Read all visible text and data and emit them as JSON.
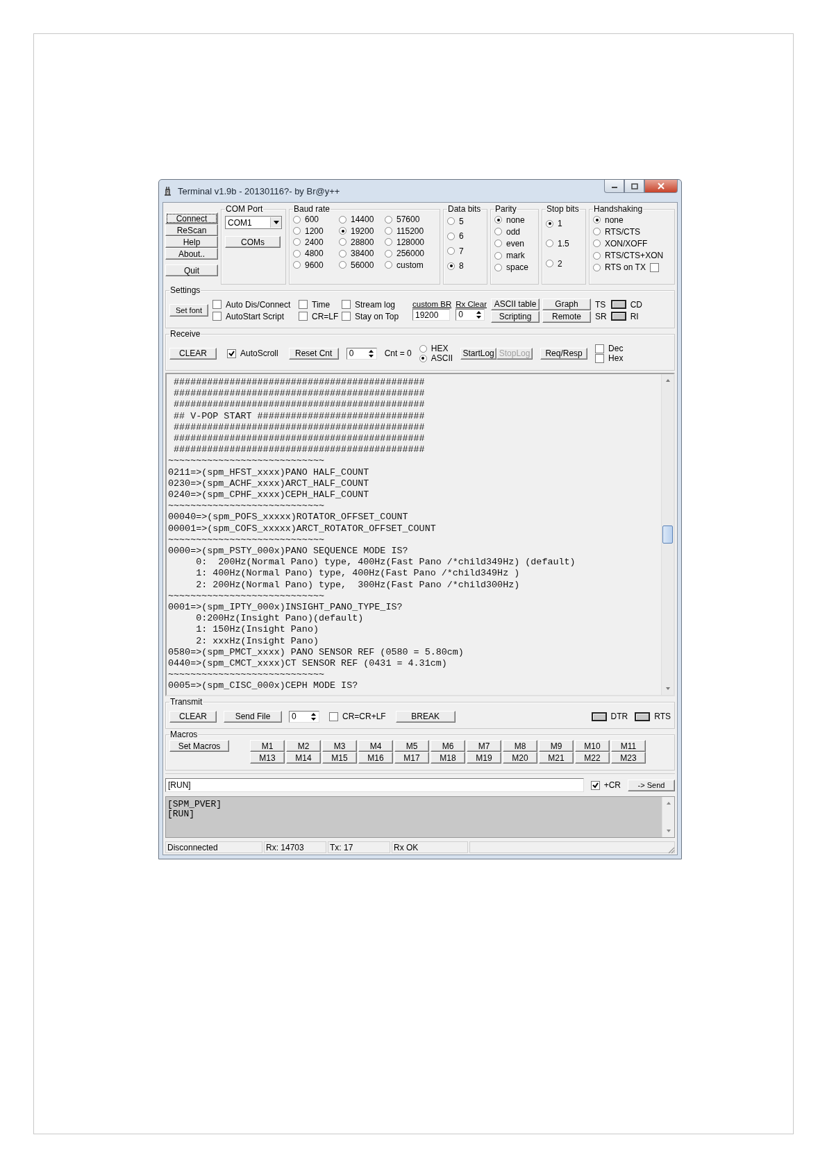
{
  "window": {
    "title": "Terminal v1.9b - 20130116?- by Br@y++"
  },
  "connection_buttons": [
    "Connect",
    "ReScan",
    "Help",
    "About..",
    "Quit"
  ],
  "com_port": {
    "title": "COM Port",
    "value": "COM1",
    "button": "COMs"
  },
  "baud_rate": {
    "title": "Baud rate",
    "options": [
      {
        "label": "600",
        "selected": false
      },
      {
        "label": "1200",
        "selected": false
      },
      {
        "label": "2400",
        "selected": false
      },
      {
        "label": "4800",
        "selected": false
      },
      {
        "label": "9600",
        "selected": false
      },
      {
        "label": "14400",
        "selected": false
      },
      {
        "label": "19200",
        "selected": true
      },
      {
        "label": "28800",
        "selected": false
      },
      {
        "label": "38400",
        "selected": false
      },
      {
        "label": "56000",
        "selected": false
      },
      {
        "label": "57600",
        "selected": false
      },
      {
        "label": "115200",
        "selected": false
      },
      {
        "label": "128000",
        "selected": false
      },
      {
        "label": "256000",
        "selected": false
      },
      {
        "label": "custom",
        "selected": false
      }
    ]
  },
  "data_bits": {
    "title": "Data bits",
    "options": [
      {
        "label": "5",
        "selected": false
      },
      {
        "label": "6",
        "selected": false
      },
      {
        "label": "7",
        "selected": false
      },
      {
        "label": "8",
        "selected": true
      }
    ]
  },
  "parity": {
    "title": "Parity",
    "options": [
      {
        "label": "none",
        "selected": true
      },
      {
        "label": "odd",
        "selected": false
      },
      {
        "label": "even",
        "selected": false
      },
      {
        "label": "mark",
        "selected": false
      },
      {
        "label": "space",
        "selected": false
      }
    ]
  },
  "stop_bits": {
    "title": "Stop bits",
    "options": [
      {
        "label": "1",
        "selected": true
      },
      {
        "label": "1.5",
        "selected": false
      },
      {
        "label": "2",
        "selected": false
      }
    ]
  },
  "handshaking": {
    "title": "Handshaking",
    "options": [
      {
        "label": "none",
        "selected": true
      },
      {
        "label": "RTS/CTS",
        "selected": false
      },
      {
        "label": "XON/XOFF",
        "selected": false
      },
      {
        "label": "RTS/CTS+XON",
        "selected": false
      },
      {
        "label": "RTS on TX",
        "selected": false
      }
    ],
    "rts_on_tx_checked": false
  },
  "settings": {
    "title": "Settings",
    "set_font": "Set font",
    "checkboxes": [
      {
        "label": "Auto Dis/Connect",
        "checked": false
      },
      {
        "label": "AutoStart Script",
        "checked": false
      },
      {
        "label": "Time",
        "checked": false
      },
      {
        "label": "CR=LF",
        "checked": false
      },
      {
        "label": "Stream log",
        "checked": false
      },
      {
        "label": "Stay on Top",
        "checked": false
      }
    ],
    "custom_br": {
      "label": "custom BR",
      "value": "19200"
    },
    "rx_clear": {
      "label": "Rx Clear",
      "value": "0"
    },
    "buttons": [
      "ASCII table",
      "Graph",
      "Scripting",
      "Remote"
    ],
    "line_labels": [
      "TS",
      "SR"
    ],
    "leds": [
      {
        "label": "CD"
      },
      {
        "label": "RI"
      }
    ]
  },
  "receive": {
    "title": "Receive",
    "clear": "CLEAR",
    "autoscroll": {
      "label": "AutoScroll",
      "checked": true
    },
    "reset_cnt": "Reset Cnt",
    "counter": "0",
    "cnt": "Cnt = 0",
    "modes": [
      {
        "label": "HEX",
        "selected": false
      },
      {
        "label": "ASCII",
        "selected": true
      }
    ],
    "log_buttons": [
      {
        "label": "StartLog",
        "disabled": false
      },
      {
        "label": "StopLog",
        "disabled": true
      }
    ],
    "req_resp": "Req/Resp",
    "formats": [
      {
        "label": "Dec",
        "checked": false
      },
      {
        "label": "Hex",
        "checked": false
      }
    ]
  },
  "terminal": {
    "lines": [
      " #############################################",
      " #############################################",
      " #############################################",
      " ## V-POP START ##############################",
      " #############################################",
      " #############################################",
      " #############################################",
      "~~~~~~~~~~~~~~~~~~~~~~~~~~~~",
      "0211=>(spm_HFST_xxxx)PANO HALF_COUNT",
      "0230=>(spm_ACHF_xxxx)ARCT_HALF_COUNT",
      "0240=>(spm_CPHF_xxxx)CEPH_HALF_COUNT",
      "~~~~~~~~~~~~~~~~~~~~~~~~~~~~",
      "00040=>(spm_POFS_xxxxx)ROTATOR_OFFSET_COUNT",
      "00001=>(spm_COFS_xxxxx)ARCT_ROTATOR_OFFSET_COUNT",
      "~~~~~~~~~~~~~~~~~~~~~~~~~~~~",
      "0000=>(spm_PSTY_000x)PANO SEQUENCE MODE IS?",
      "     0:  200Hz(Normal Pano) type, 400Hz(Fast Pano /*child349Hz) (default)",
      "     1: 400Hz(Normal Pano) type, 400Hz(Fast Pano /*child349Hz )",
      "     2: 200Hz(Normal Pano) type,  300Hz(Fast Pano /*child300Hz)",
      "~~~~~~~~~~~~~~~~~~~~~~~~~~~~",
      "0001=>(spm_IPTY_000x)INSIGHT_PANO_TYPE_IS?",
      "     0:200Hz(Insight Pano)(default)",
      "     1: 150Hz(Insight Pano)",
      "     2: xxxHz(Insight Pano)",
      "0580=>(spm_PMCT_xxxx) PANO SENSOR REF (0580 = 5.80cm)",
      "0440=>(spm_CMCT_xxxx)CT SENSOR REF (0431 = 4.31cm)",
      "~~~~~~~~~~~~~~~~~~~~~~~~~~~~",
      "0005=>(spm_CISC_000x)CEPH MODE IS?"
    ]
  },
  "transmit": {
    "title": "Transmit",
    "clear": "CLEAR",
    "send_file": "Send File",
    "counter": "0",
    "cr_lf": {
      "label": "CR=CR+LF",
      "checked": false
    },
    "break": "BREAK",
    "leds": [
      {
        "label": "DTR"
      },
      {
        "label": "RTS"
      }
    ]
  },
  "macros": {
    "title": "Macros",
    "set_macros": "Set Macros",
    "rows": [
      [
        "M1",
        "M2",
        "M3",
        "M4",
        "M5",
        "M6",
        "M7",
        "M8",
        "M9",
        "M10",
        "M11"
      ],
      [
        "M13",
        "M14",
        "M15",
        "M16",
        "M17",
        "M18",
        "M19",
        "M20",
        "M21",
        "M22",
        "M23"
      ]
    ]
  },
  "send_bar": {
    "value": "[RUN]",
    "plus_cr": {
      "label": "+CR",
      "checked": true
    },
    "send": "-> Send"
  },
  "history": {
    "lines": [
      "[SPM_PVER]",
      "[RUN]"
    ]
  },
  "status_bar": [
    "Disconnected",
    "Rx: 14703",
    "Tx: 17",
    "Rx OK"
  ]
}
